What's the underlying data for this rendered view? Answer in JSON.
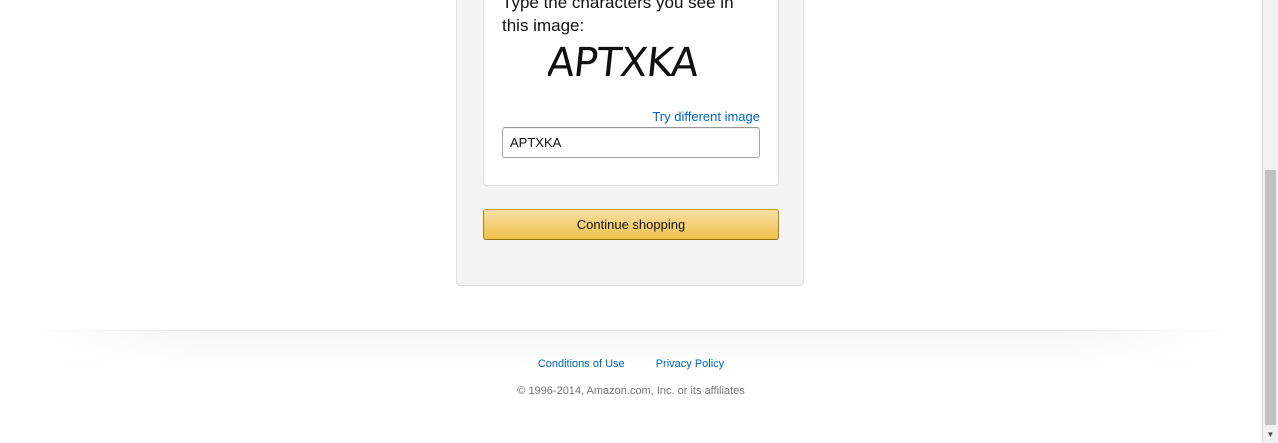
{
  "captcha": {
    "prompt": "Type the characters you see in this image:",
    "image_text": "APTXKA",
    "try_different_label": "Try different image",
    "input_value": "APTXKA"
  },
  "actions": {
    "continue_label": "Continue shopping"
  },
  "footer": {
    "conditions_label": "Conditions of Use",
    "privacy_label": "Privacy Policy",
    "copyright": "© 1996-2014, Amazon.com, Inc. or its affiliates"
  },
  "scrollbar": {
    "down_arrow_icon": "triangle-down"
  }
}
